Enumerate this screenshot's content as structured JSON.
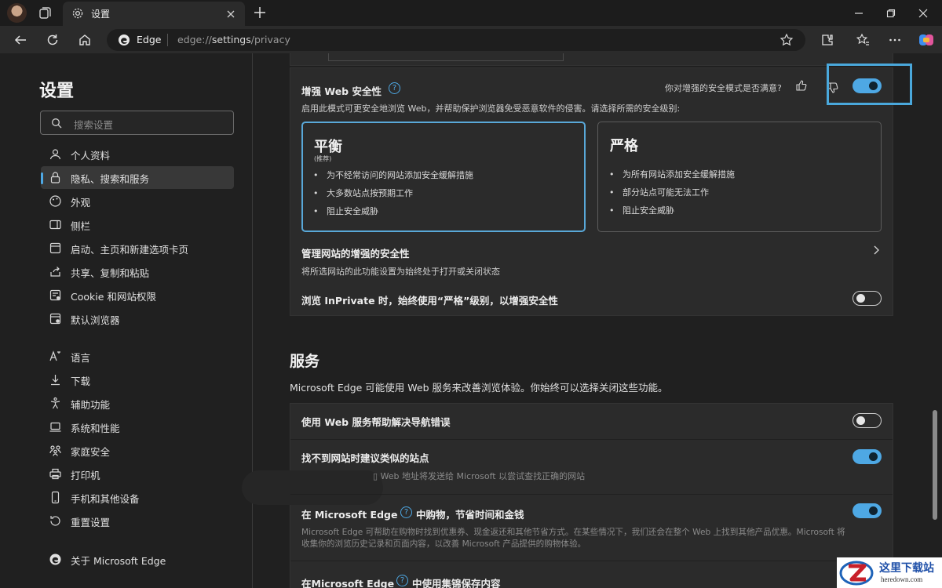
{
  "browser": {
    "tab_title": "设置",
    "address_brand": "Edge",
    "address_url_prefix": "edge://",
    "address_url_host": "settings",
    "address_url_path": "/privacy"
  },
  "sidebar": {
    "title": "设置",
    "search_placeholder": "搜索设置",
    "items": [
      {
        "label": "个人资料",
        "icon": "profile-icon",
        "active": false
      },
      {
        "label": "隐私、搜索和服务",
        "icon": "lock-icon",
        "active": true
      },
      {
        "label": "外观",
        "icon": "appearance-icon",
        "active": false
      },
      {
        "label": "侧栏",
        "icon": "sidebar-icon",
        "active": false
      },
      {
        "label": "启动、主页和新建选项卡页",
        "icon": "home-pages-icon",
        "active": false
      },
      {
        "label": "共享、复制和粘贴",
        "icon": "share-icon",
        "active": false
      },
      {
        "label": "Cookie 和网站权限",
        "icon": "site-permissions-icon",
        "active": false
      },
      {
        "label": "默认浏览器",
        "icon": "default-browser-icon",
        "active": false
      },
      {
        "label": "语言",
        "icon": "language-icon",
        "active": false
      },
      {
        "label": "下载",
        "icon": "download-icon",
        "active": false
      },
      {
        "label": "辅助功能",
        "icon": "accessibility-icon",
        "active": false
      },
      {
        "label": "系统和性能",
        "icon": "laptop-icon",
        "active": false
      },
      {
        "label": "家庭安全",
        "icon": "family-icon",
        "active": false
      },
      {
        "label": "打印机",
        "icon": "printer-icon",
        "active": false
      },
      {
        "label": "手机和其他设备",
        "icon": "phone-icon",
        "active": false
      },
      {
        "label": "重置设置",
        "icon": "reset-icon",
        "active": false
      },
      {
        "label": "关于 Microsoft Edge",
        "icon": "edge-logo-icon",
        "active": false
      }
    ]
  },
  "security": {
    "title": "增强 Web 安全性",
    "feedback_question": "你对增强的安全模式是否满意?",
    "enabled": true,
    "description": "启用此模式可更安全地浏览 Web，并帮助保护浏览器免受恶意软件的侵害。请选择所需的安全级别:",
    "modes": [
      {
        "title": "平衡",
        "subtitle": "(推荐)",
        "selected": true,
        "bullets": [
          "为不经常访问的网站添加安全缓解措施",
          "大多数站点按预期工作",
          "阻止安全威胁"
        ]
      },
      {
        "title": "严格",
        "subtitle": "",
        "selected": false,
        "bullets": [
          "为所有网站添加安全缓解措施",
          "部分站点可能无法工作",
          "阻止安全威胁"
        ]
      }
    ],
    "manage_title": "管理网站的增强的安全性",
    "manage_desc": "将所选网站的此功能设置为始终处于打开或关闭状态",
    "inprivate_label": "浏览 InPrivate 时，始终使用“严格”级别，以增强安全性",
    "inprivate_enabled": false
  },
  "services": {
    "heading": "服务",
    "intro": "Microsoft Edge 可能使用 Web 服务来改善浏览体验。你始终可以选择关闭这些功能。",
    "rows": [
      {
        "title": "使用 Web 服务帮助解决导航错误",
        "enabled": false
      },
      {
        "title": "找不到网站时建议类似的站点",
        "desc": "Web 地址将发送给 Microsoft 以尝试查找正确的网站",
        "enabled": true
      },
      {
        "title_before": "在 Microsoft Edge",
        "title_after": "中购物，节省时间和金钱",
        "desc_line1": "Microsoft Edge 可帮助在购物时找到优惠券、现金返还和其他节省方式。在某些情况下，我们还会在整个 Web 上找到其他产品优惠。Microsoft 将",
        "desc_line2": "收集你的浏览历史记录和页面内容，以改善 Microsoft 产品提供的购物体验。",
        "enabled": true
      },
      {
        "title_before": "在Microsoft Edge",
        "title_after": "中使用集锦保存内容"
      }
    ]
  },
  "watermark": {
    "text": "这里下载站",
    "url": "heredown.com"
  },
  "colors": {
    "accent": "#4ea8e4",
    "background": "#202020",
    "card": "#2b2b2b"
  }
}
